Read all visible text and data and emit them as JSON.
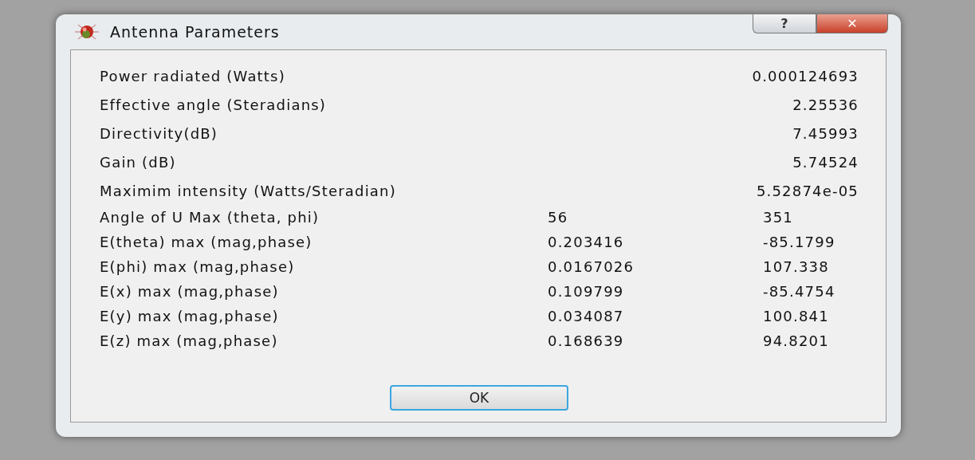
{
  "window": {
    "title": "Antenna Parameters",
    "help_button": "?",
    "close_button": "✕"
  },
  "rows": [
    {
      "kind": "single",
      "label": "Power radiated (Watts)",
      "values": [
        "0.000124693"
      ]
    },
    {
      "kind": "single",
      "label": "Effective angle (Steradians)",
      "values": [
        "2.25536"
      ]
    },
    {
      "kind": "single",
      "label": "Directivity(dB)",
      "values": [
        "7.45993"
      ]
    },
    {
      "kind": "single",
      "label": "Gain (dB)",
      "values": [
        "5.74524"
      ]
    },
    {
      "kind": "single",
      "label": "Maximim intensity (Watts/Steradian)",
      "values": [
        "5.52874e-05"
      ]
    },
    {
      "kind": "pair",
      "label": "Angle of U Max (theta, phi)",
      "values": [
        "56",
        "351"
      ]
    },
    {
      "kind": "pair",
      "label": "E(theta) max (mag,phase)",
      "values": [
        "0.203416",
        "-85.1799"
      ]
    },
    {
      "kind": "pair",
      "label": "E(phi) max (mag,phase)",
      "values": [
        "0.0167026",
        "107.338"
      ]
    },
    {
      "kind": "pair",
      "label": "E(x) max (mag,phase)",
      "values": [
        "0.109799",
        "-85.4754"
      ]
    },
    {
      "kind": "pair",
      "label": "E(y) max (mag,phase)",
      "values": [
        "0.034087",
        "100.841"
      ]
    },
    {
      "kind": "pair",
      "label": "E(z) max (mag,phase)",
      "values": [
        "0.168639",
        "94.8201"
      ]
    }
  ],
  "buttons": [
    "OK"
  ]
}
